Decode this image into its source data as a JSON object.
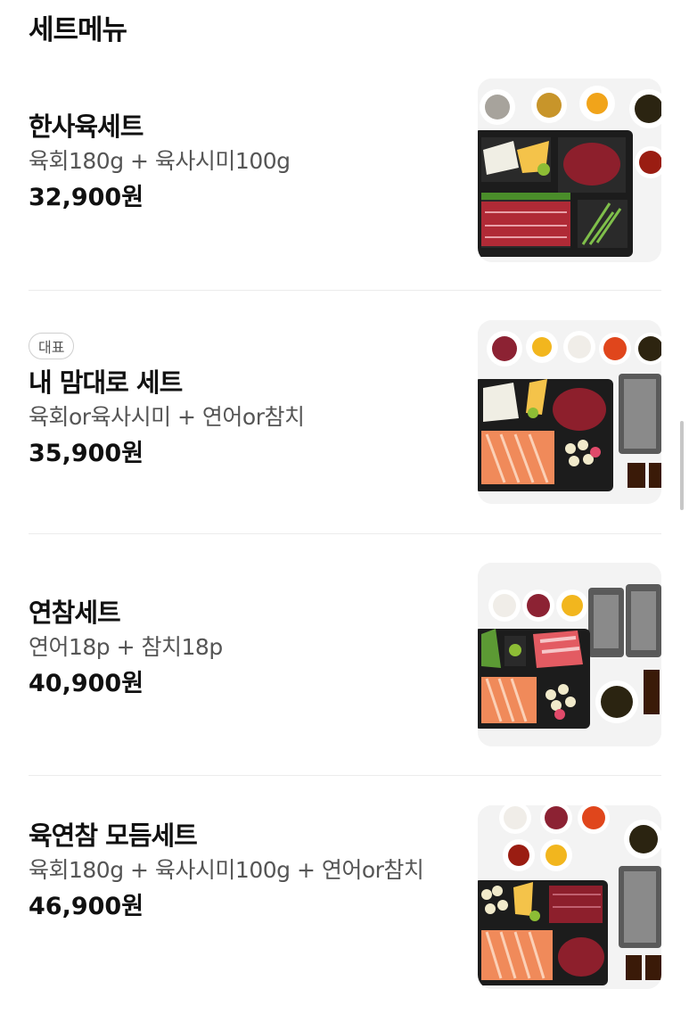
{
  "section": {
    "title": "세트메뉴"
  },
  "items": [
    {
      "name": "한사육세트",
      "badge": "",
      "desc": "육회180g + 육사시미100g",
      "price": "32,900원"
    },
    {
      "name": "내 맘대로 세트",
      "badge": "대표",
      "desc": "육회or육사시미 + 연어or참치",
      "price": "35,900원"
    },
    {
      "name": "연참세트",
      "badge": "",
      "desc": "연어18p + 참치18p",
      "price": "40,900원"
    },
    {
      "name": "육연참 모듬세트",
      "badge": "",
      "desc": "육회180g + 육사시미100g + 연어or참치",
      "price": "46,900원"
    }
  ],
  "colors": {
    "beef": "#9e1f2a",
    "salmon": "#f08a5a",
    "tray": "#1c1c1c",
    "tuna": "#d9646a"
  }
}
